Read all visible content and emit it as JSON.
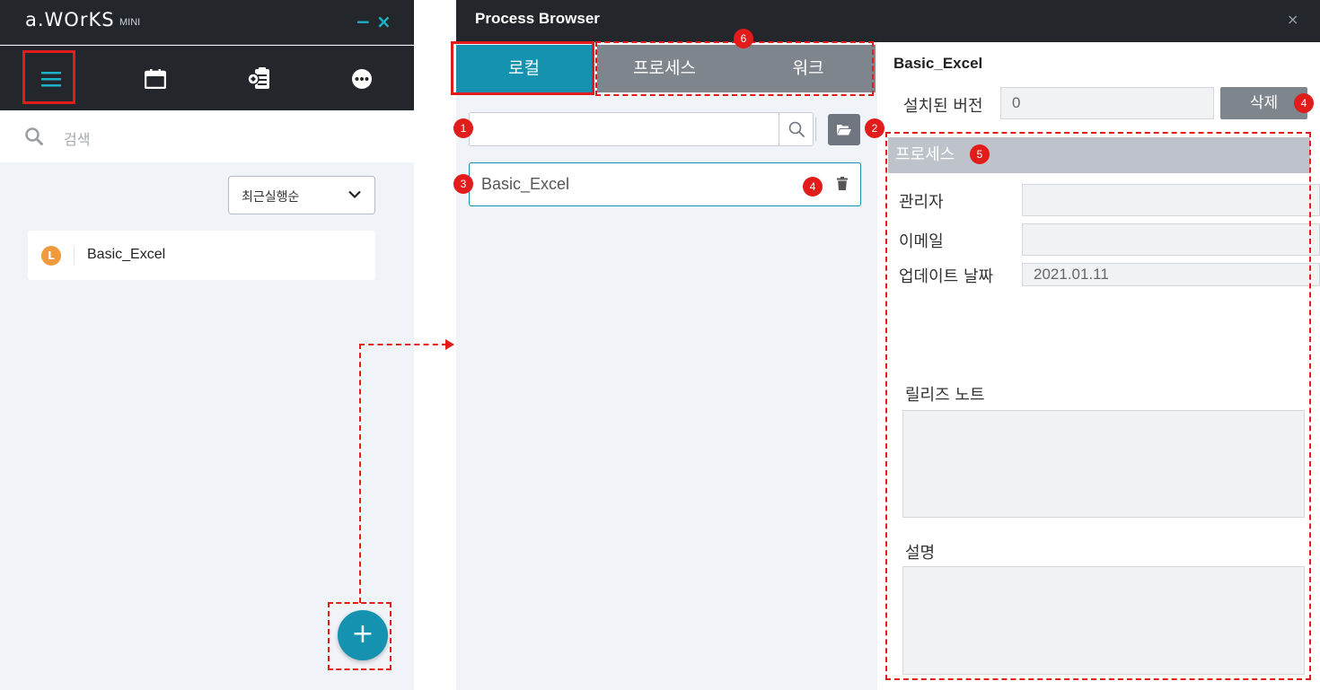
{
  "mini_app": {
    "logo": "a.WOrKS",
    "logo_suffix": "MINI",
    "minimize_glyph": "−",
    "close_glyph": "×",
    "nav_icons": [
      "menu-icon",
      "calendar-icon",
      "clipboard-icon",
      "more-icon"
    ],
    "search_placeholder": "검색",
    "sort": {
      "selected": "최근실행순"
    },
    "processes": [
      {
        "badge": "L",
        "name": "Basic_Excel"
      }
    ],
    "fab_glyph": "+"
  },
  "process_browser": {
    "title": "Process Browser",
    "close_glyph": "×",
    "tabs": [
      {
        "label": "로컬"
      },
      {
        "label": "프로세스"
      },
      {
        "label": "워크"
      }
    ],
    "search": {
      "placeholder": "",
      "value": ""
    },
    "items": [
      {
        "name": "Basic_Excel"
      }
    ],
    "detail": {
      "title": "Basic_Excel",
      "installed_version_label": "설치된 버전",
      "installed_version_value": "0",
      "delete_button": "삭제",
      "section_title": "프로세스",
      "manager_label": "관리자",
      "manager_value": "",
      "email_label": "이메일",
      "email_value": "",
      "update_date_label": "업데이트 날짜",
      "update_date_value": "2021.01.11",
      "release_notes_label": "릴리즈 노트",
      "release_notes_value": "",
      "description_label": "설명",
      "description_value": ""
    }
  },
  "callouts": [
    "1",
    "2",
    "3",
    "4",
    "4",
    "5",
    "6"
  ],
  "colors": {
    "dark_bar": "#23272c",
    "accent": "#1592b0",
    "annotation": "#e21b1b",
    "tab_inactive": "#7f858d",
    "badge_orange": "#f09a3e"
  }
}
